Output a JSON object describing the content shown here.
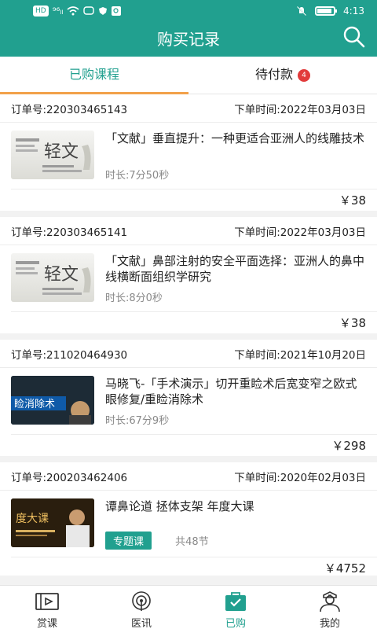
{
  "status_bar": {
    "network": "HD",
    "signal": "⁹⁶ₗₗ",
    "time": "4:13",
    "battery_level": 0.8
  },
  "header": {
    "title": "购买记录",
    "search_icon": "search-icon"
  },
  "tabs": [
    {
      "label": "已购课程",
      "active": true
    },
    {
      "label": "待付款",
      "badge": "4",
      "active": false
    }
  ],
  "orders": [
    {
      "order_no": "订单号:220303465143",
      "order_time": "下单时间:2022年03月03日",
      "title": "「文献」垂直提升：一种更适合亚洲人的线雕技术",
      "duration": "时长:7分50秒",
      "price": "￥38",
      "thumb_text": "轻文"
    },
    {
      "order_no": "订单号:220303465141",
      "order_time": "下单时间:2022年03月03日",
      "title": "「文献」鼻部注射的安全平面选择：亚洲人的鼻中线横断面组织学研究",
      "duration": "时长:8分0秒",
      "price": "￥38",
      "thumb_text": "轻文"
    },
    {
      "order_no": "订单号:211020464930",
      "order_time": "下单时间:2021年10月20日",
      "title": "马晓飞-「手术演示」切开重睑术后宽变窄之欧式眼修复/重睑消除术",
      "duration": "时长:67分9秒",
      "price": "￥298",
      "thumb_text": "睑消除术"
    },
    {
      "order_no": "订单号:200203462406",
      "order_time": "下单时间:2020年02月03日",
      "title": "谭鼻论道 拯体支架 年度大课",
      "tag": "专题课",
      "lessons": "共48节",
      "price": "￥4752",
      "thumb_text": "度大课"
    }
  ],
  "bottom_nav": [
    {
      "label": "赏课",
      "icon": "video-icon",
      "active": false
    },
    {
      "label": "医讯",
      "icon": "broadcast-icon",
      "active": false
    },
    {
      "label": "已购",
      "icon": "purchased-bag-icon",
      "active": true
    },
    {
      "label": "我的",
      "icon": "doctor-profile-icon",
      "active": false
    }
  ],
  "colors": {
    "primary": "#21a08f",
    "tab_underline": "#f2a14a",
    "badge": "#e23b3b"
  }
}
